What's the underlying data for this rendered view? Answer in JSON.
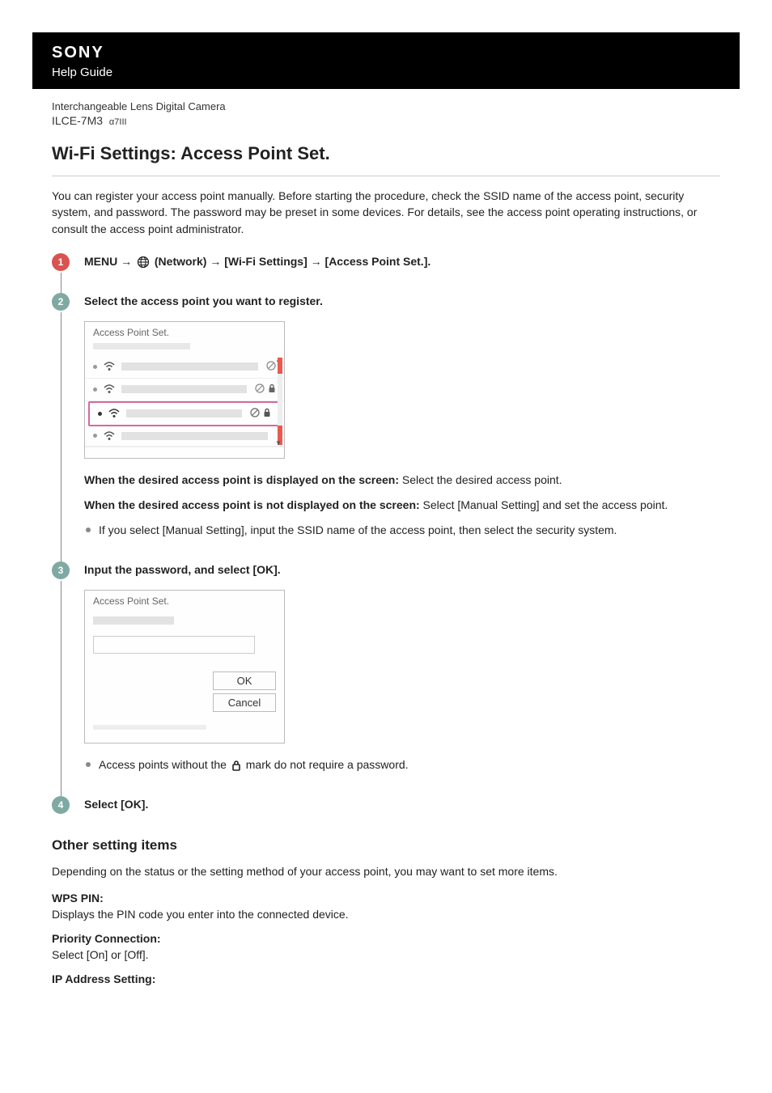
{
  "header": {
    "brand": "SONY",
    "help_guide": "Help Guide"
  },
  "meta": {
    "product_line": "Interchangeable Lens Digital Camera",
    "model": "ILCE-7M3",
    "model_suffix": "α7III"
  },
  "title": "Wi-Fi Settings: Access Point Set.",
  "intro": "You can register your access point manually. Before starting the procedure, check the SSID name of the access point, security system, and password. The password may be preset in some devices. For details, see the access point operating instructions, or consult the access point administrator.",
  "steps": {
    "s1": {
      "num": "1",
      "text_pre": "MENU → ",
      "text_icon_label": "(Network)",
      "text_post": " → [Wi-Fi Settings] → [Access Point Set.]."
    },
    "s2": {
      "num": "2",
      "head": "Select the access point you want to register.",
      "screenshot_title": "Access Point Set.",
      "displayed_label": "When the desired access point is displayed on the screen:",
      "displayed_text": " Select the desired access point.",
      "not_displayed_label": "When the desired access point is not displayed on the screen:",
      "not_displayed_text": " Select [Manual Setting] and set the access point.",
      "bullet1": "If you select [Manual Setting], input the SSID name of the access point, then select the security system."
    },
    "s3": {
      "num": "3",
      "head": "Input the password, and select [OK].",
      "screenshot_title": "Access Point Set.",
      "ok_label": "OK",
      "cancel_label": "Cancel",
      "bullet_pre": "Access points without the ",
      "bullet_post": " mark do not require a password."
    },
    "s4": {
      "num": "4",
      "head": "Select [OK]."
    }
  },
  "other": {
    "heading": "Other setting items",
    "intro": "Depending on the status or the setting method of your access point, you may want to set more items.",
    "wps_pin_dt": "WPS PIN:",
    "wps_pin_dd": "Displays the PIN code you enter into the connected device.",
    "priority_dt": "Priority Connection:",
    "priority_dd": "Select [On] or [Off].",
    "ip_dt": "IP Address Setting:"
  }
}
